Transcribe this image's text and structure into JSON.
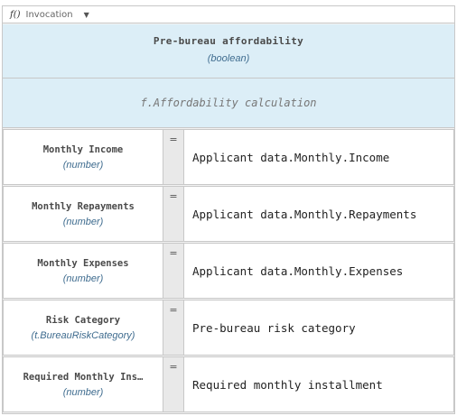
{
  "toolbar": {
    "fx_label": "f()",
    "kind_label": "Invocation",
    "caret": "▼"
  },
  "decision": {
    "name": "Pre-bureau affordability",
    "type": "(boolean)"
  },
  "function": {
    "name": "f.Affordability calculation"
  },
  "bindings": [
    {
      "param": "Monthly Income",
      "type": "(number)",
      "eq": "=",
      "value": "Applicant data.Monthly.Income"
    },
    {
      "param": "Monthly Repayments",
      "type": "(number)",
      "eq": "=",
      "value": "Applicant data.Monthly.Repayments"
    },
    {
      "param": "Monthly Expenses",
      "type": "(number)",
      "eq": "=",
      "value": "Applicant data.Monthly.Expenses"
    },
    {
      "param": "Risk Category",
      "type": "(t.BureauRiskCategory)",
      "eq": "=",
      "value": "Pre-bureau risk category"
    },
    {
      "param": "Required Monthly Ins…",
      "type": "(number)",
      "eq": "=",
      "value": "Required monthly installment"
    }
  ]
}
